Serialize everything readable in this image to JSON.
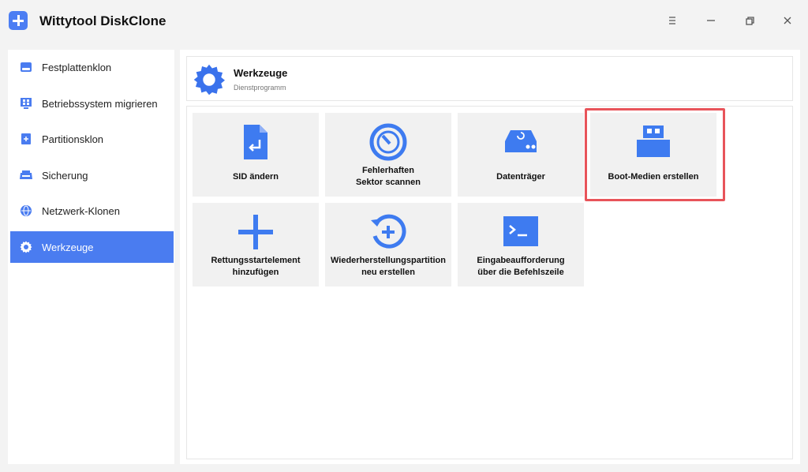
{
  "app": {
    "title": "Wittytool DiskClone",
    "accent_color": "#4a7cf0",
    "icon": "plus-icon"
  },
  "window_controls": {
    "menu_icon": "menu-icon",
    "minimize_icon": "minimize-icon",
    "restore_icon": "restore-icon",
    "close_icon": "close-icon"
  },
  "sidebar": {
    "items": [
      {
        "label": "Festplattenklon",
        "icon": "disk-icon"
      },
      {
        "label": "Betriebssystem migrieren",
        "icon": "windows-icon"
      },
      {
        "label": "Partitionsklon",
        "icon": "partition-icon"
      },
      {
        "label": "Sicherung",
        "icon": "backup-icon"
      },
      {
        "label": "Netzwerk-Klonen",
        "icon": "network-icon"
      },
      {
        "label": "Werkzeuge",
        "icon": "gear-icon",
        "active": true
      }
    ]
  },
  "header": {
    "title": "Werkzeuge",
    "subtitle": "Dienstprogramm",
    "icon": "gear-icon"
  },
  "tools": [
    {
      "label": "SID ändern",
      "icon": "file-edit-icon"
    },
    {
      "label": "Fehlerhaften\nSektor scannen",
      "icon": "scan-dial-icon"
    },
    {
      "label": "Datenträger",
      "icon": "drive-icon"
    },
    {
      "label": "Boot-Medien erstellen",
      "icon": "boot-media-icon",
      "highlighted": true
    },
    {
      "label": "Rettungsstartelement\nhinzufügen",
      "icon": "plus-icon"
    },
    {
      "label": "Wiederherstellungspartition\nneu erstellen",
      "icon": "restore-plus-icon"
    },
    {
      "label": "Eingabeaufforderung\nüber die Befehlszeile",
      "icon": "terminal-icon"
    }
  ],
  "highlight_color": "#e8545a"
}
